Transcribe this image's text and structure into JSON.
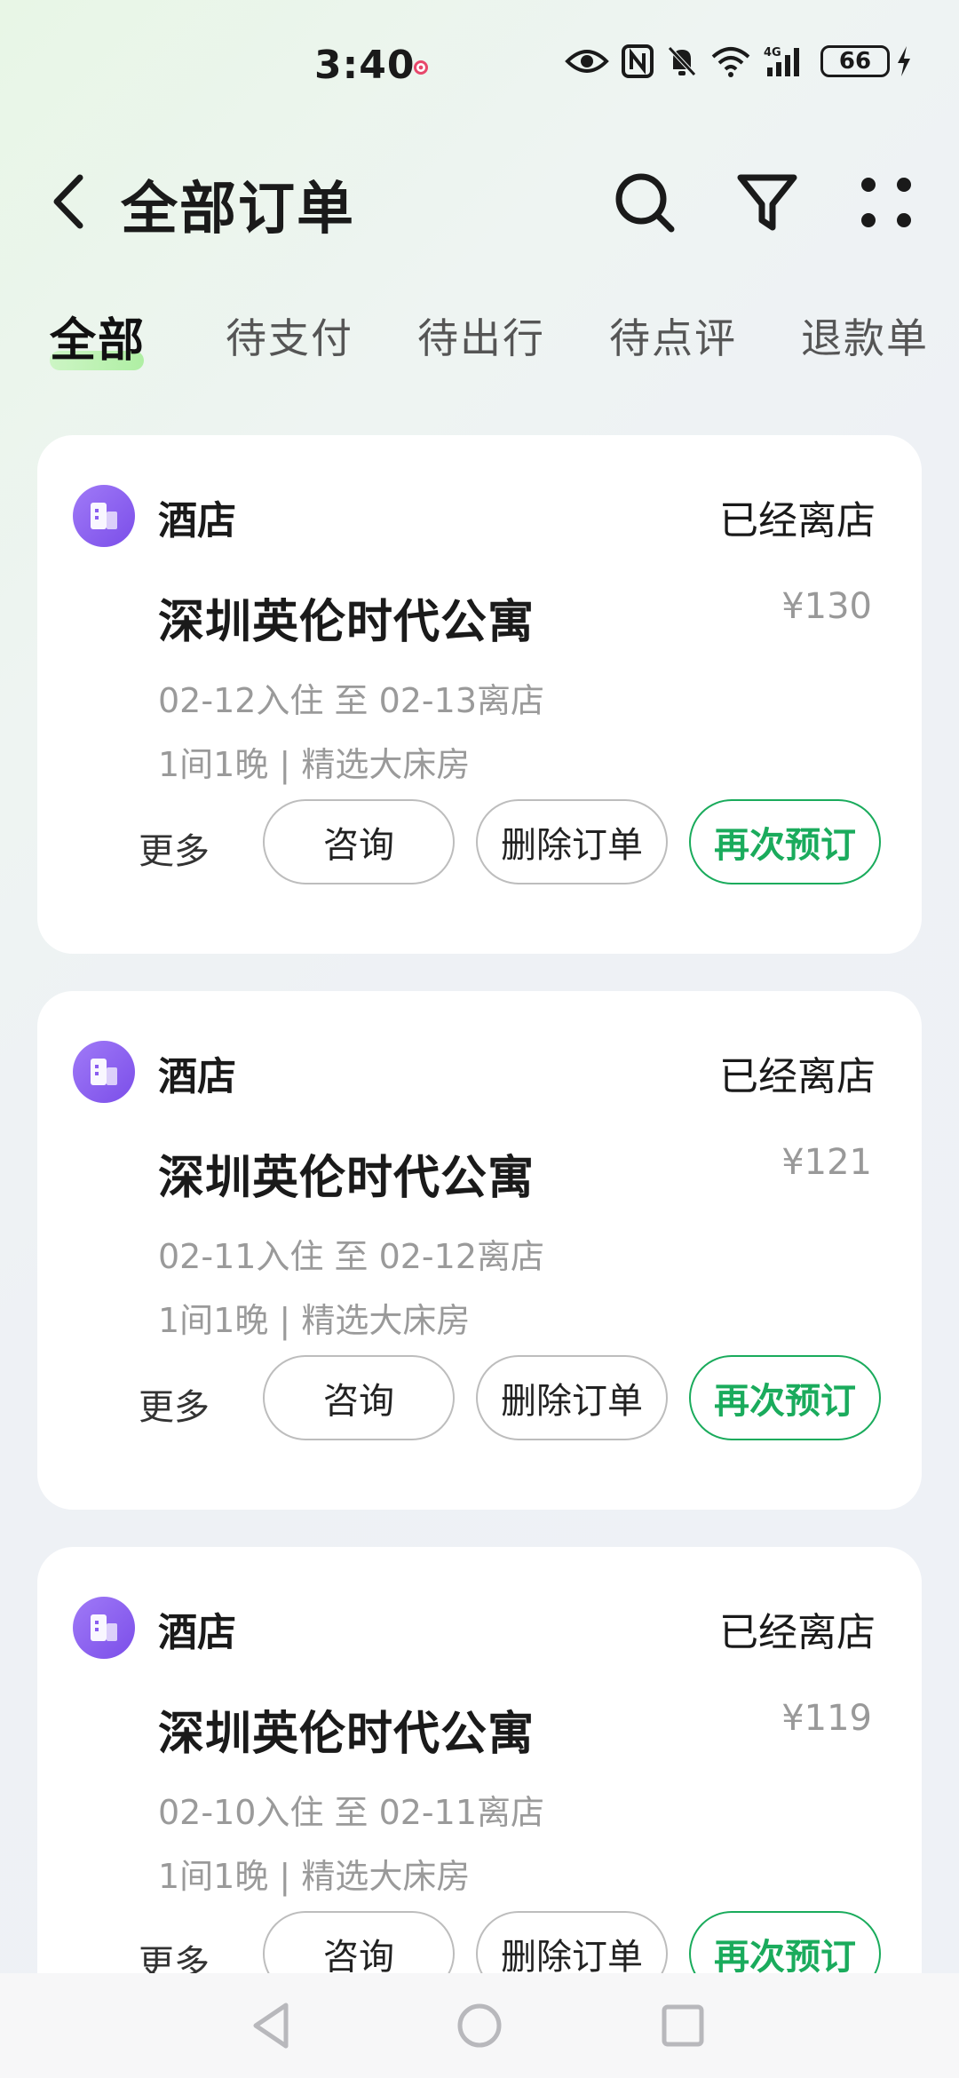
{
  "status_bar": {
    "time": "3:40",
    "battery": "66",
    "icons": [
      "eye-icon",
      "nfc-icon",
      "bell-muted-icon",
      "wifi-icon",
      "signal-4g-icon",
      "battery-icon",
      "charging-icon"
    ]
  },
  "header": {
    "title": "全部订单",
    "icons": [
      "back-arrow-icon",
      "search-icon",
      "filter-icon",
      "more-dots-icon"
    ]
  },
  "tabs": [
    {
      "label": "全部",
      "active": true
    },
    {
      "label": "待支付",
      "active": false
    },
    {
      "label": "待出行",
      "active": false
    },
    {
      "label": "待点评",
      "active": false
    },
    {
      "label": "退款单",
      "active": false
    }
  ],
  "orders": [
    {
      "category": "酒店",
      "status": "已经离店",
      "hotel_name": "深圳英伦时代公寓",
      "price": "¥130",
      "dates": "02-12入住 至 02-13离店",
      "room": "1间1晚 | 精选大床房"
    },
    {
      "category": "酒店",
      "status": "已经离店",
      "hotel_name": "深圳英伦时代公寓",
      "price": "¥121",
      "dates": "02-11入住 至 02-12离店",
      "room": "1间1晚 | 精选大床房"
    },
    {
      "category": "酒店",
      "status": "已经离店",
      "hotel_name": "深圳英伦时代公寓",
      "price": "¥119",
      "dates": "02-10入住 至 02-11离店",
      "room": "1间1晚 | 精选大床房"
    }
  ],
  "order_actions": {
    "more": "更多",
    "consult": "咨询",
    "delete": "删除订单",
    "rebook": "再次预订"
  },
  "colors": {
    "accent_green": "#1aab5c",
    "hotel_icon_purple": "#8a5cf0",
    "muted_text": "#9a9a9a"
  }
}
